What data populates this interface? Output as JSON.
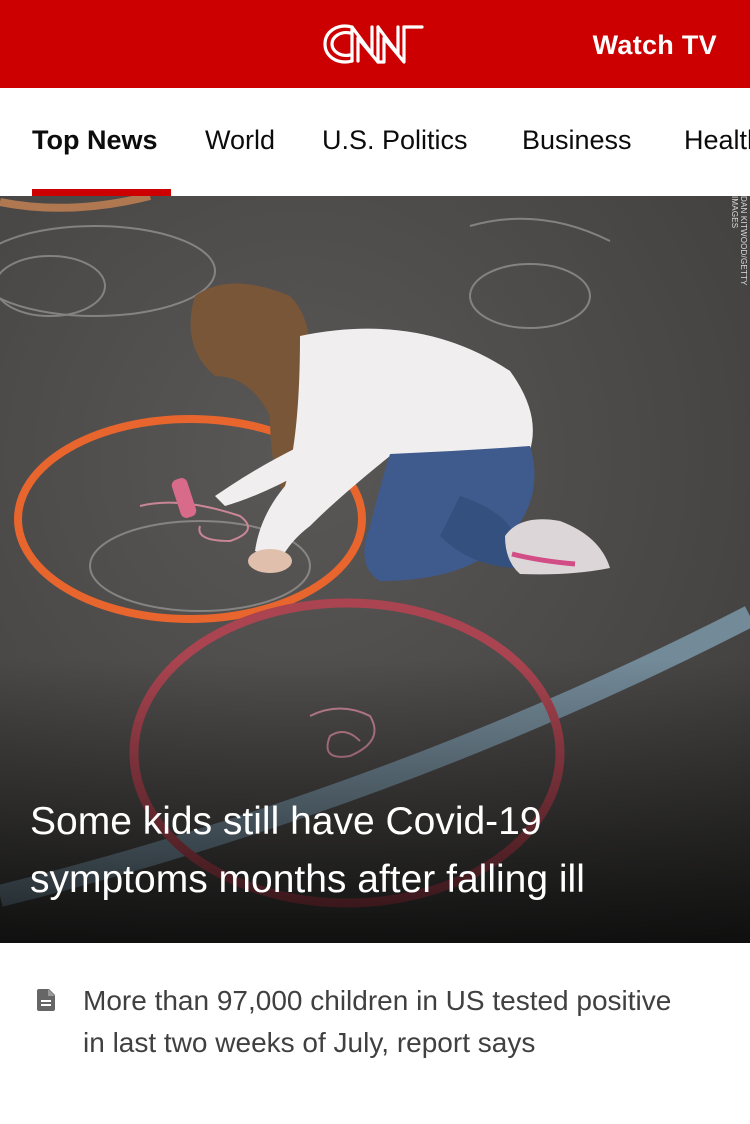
{
  "header": {
    "logo_text": "CNN",
    "watch_tv_label": "Watch TV"
  },
  "nav": {
    "tabs": [
      {
        "label": "Top News",
        "active": true
      },
      {
        "label": "World",
        "active": false
      },
      {
        "label": "U.S. Politics",
        "active": false
      },
      {
        "label": "Business",
        "active": false
      },
      {
        "label": "Health",
        "active": false
      }
    ],
    "active_color": "#cc0000"
  },
  "hero": {
    "headline": "Some kids still have Covid-19 symptoms months after falling ill",
    "photo_credit": "DAN KITWOOD/GETTY IMAGES",
    "image_description_icon": "photo-girl-chalk-hula-hoops"
  },
  "story": {
    "icon": "document-icon",
    "text": "More than 97,000 children in US tested positive in last two weeks of July, report says"
  },
  "colors": {
    "brand_red": "#cc0000",
    "headline_text": "#ffffff",
    "story_text": "#404040"
  }
}
